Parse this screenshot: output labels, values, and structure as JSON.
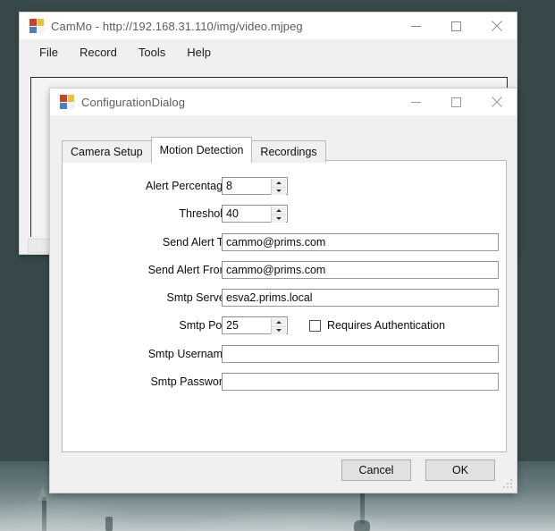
{
  "main_window": {
    "title": "CamMo - http://192.168.31.110/img/video.mjpeg",
    "icon": "app-icon",
    "menu": [
      {
        "label": "File"
      },
      {
        "label": "Record"
      },
      {
        "label": "Tools"
      },
      {
        "label": "Help"
      }
    ],
    "controls": {
      "minimize": "minimize-icon",
      "maximize": "maximize-icon",
      "close": "close-icon"
    }
  },
  "dialog": {
    "title": "ConfigurationDialog",
    "icon": "app-icon",
    "controls": {
      "minimize": "minimize-icon",
      "maximize": "maximize-icon",
      "close": "close-icon"
    },
    "tabs": [
      {
        "label": "Camera Setup",
        "selected": false
      },
      {
        "label": "Motion Detection",
        "selected": true
      },
      {
        "label": "Recordings",
        "selected": false
      }
    ],
    "fields": [
      {
        "label": "Alert Percentage",
        "value": "8",
        "type": "spin",
        "placeholder": ""
      },
      {
        "label": "Threshold",
        "value": "40",
        "type": "spin",
        "placeholder": ""
      },
      {
        "label": "Send Alert To",
        "value": "cammo@prims.com",
        "type": "text",
        "placeholder": ""
      },
      {
        "label": "Send Alert From",
        "value": "cammo@prims.com",
        "type": "text",
        "placeholder": ""
      },
      {
        "label": "Smtp Server",
        "value": "esva2.prims.local",
        "type": "text",
        "placeholder": ""
      },
      {
        "label": "Smtp Port",
        "value": "25",
        "type": "spin",
        "placeholder": ""
      },
      {
        "label": "Smtp Username",
        "value": "",
        "type": "text",
        "placeholder": ""
      },
      {
        "label": "Smtp Password",
        "value": "",
        "type": "password",
        "placeholder": ""
      }
    ],
    "checkbox": {
      "label": "Requires Authentication",
      "checked": false
    },
    "buttons": {
      "cancel": "Cancel",
      "ok": "OK"
    },
    "resize_grip": "resize-grip-icon"
  },
  "colors": {
    "desktop": "#37494a",
    "window_face": "#f0f0f0",
    "titlebar": "#ffffff",
    "tabpage": "#ffffff",
    "title_text": "#5d5d5d",
    "body_text": "#0c0c0c",
    "control_border": "#9a9a9a",
    "button_face": "#e1e1e1"
  }
}
